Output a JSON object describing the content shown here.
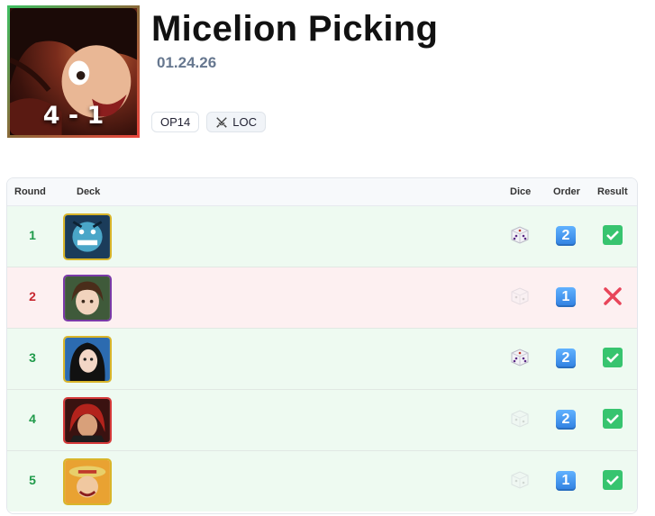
{
  "header": {
    "title": "Micelion Picking",
    "date": "01.24.26",
    "score": "4 - 1",
    "tags": [
      {
        "label": "OP14",
        "icon": ""
      },
      {
        "label": "LOC",
        "icon": "crossed-swords-icon"
      }
    ]
  },
  "table": {
    "columns": {
      "round": "Round",
      "deck": "Deck",
      "dice": "Dice",
      "order": "Order",
      "result": "Result"
    },
    "rows": [
      {
        "round": "1",
        "deck_icon": "blue-monster-leader-icon",
        "dice": "won-dice",
        "order": "2",
        "result": "win"
      },
      {
        "round": "2",
        "deck_icon": "brown-hair-girl-leader-icon",
        "dice": "lost-dice",
        "order": "1",
        "result": "loss"
      },
      {
        "round": "3",
        "deck_icon": "black-hair-woman-leader-icon",
        "dice": "won-dice",
        "order": "2",
        "result": "win"
      },
      {
        "round": "4",
        "deck_icon": "red-hair-man-leader-icon",
        "dice": "lost-dice",
        "order": "2",
        "result": "win"
      },
      {
        "round": "5",
        "deck_icon": "straw-hat-leader-icon",
        "dice": "lost-dice",
        "order": "1",
        "result": "win"
      }
    ]
  },
  "colors": {
    "win": "#eefaf1",
    "loss": "#fdf0f1",
    "win_text": "#1f9a4a",
    "loss_text": "#c7262f",
    "check": "#2fbf6a",
    "cross": "#e8455a",
    "order": "#3d8ff0"
  }
}
